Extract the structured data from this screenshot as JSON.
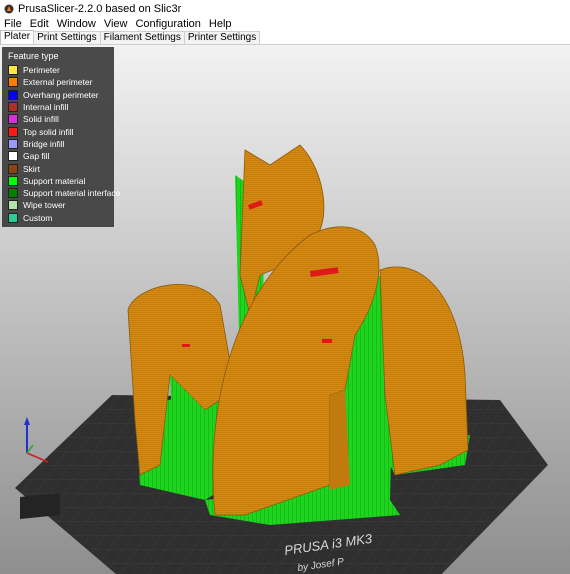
{
  "window": {
    "title": "PrusaSlicer-2.2.0 based on Slic3r",
    "icon": "prusa-slicer-icon"
  },
  "menu": [
    "File",
    "Edit",
    "Window",
    "View",
    "Configuration",
    "Help"
  ],
  "tabs": [
    {
      "label": "Plater",
      "active": true
    },
    {
      "label": "Print Settings",
      "active": false
    },
    {
      "label": "Filament Settings",
      "active": false
    },
    {
      "label": "Printer Settings",
      "active": false
    }
  ],
  "legend": {
    "title": "Feature type",
    "items": [
      {
        "label": "Perimeter",
        "color": "#FFE63A"
      },
      {
        "label": "External perimeter",
        "color": "#FF7D00"
      },
      {
        "label": "Overhang perimeter",
        "color": "#0000FF"
      },
      {
        "label": "Internal infill",
        "color": "#B03029"
      },
      {
        "label": "Solid infill",
        "color": "#D732D7"
      },
      {
        "label": "Top solid infill",
        "color": "#FF1A1A"
      },
      {
        "label": "Bridge infill",
        "color": "#9999FF"
      },
      {
        "label": "Gap fill",
        "color": "#FFFFFF"
      },
      {
        "label": "Skirt",
        "color": "#8B4513"
      },
      {
        "label": "Support material",
        "color": "#00FF00"
      },
      {
        "label": "Support material interface",
        "color": "#008000"
      },
      {
        "label": "Wipe tower",
        "color": "#B3E3AB"
      },
      {
        "label": "Custom",
        "color": "#28CC94"
      }
    ]
  },
  "bed": {
    "label_line1": "PRUSA i3 MK3",
    "label_line2": "by Josef P"
  },
  "colors": {
    "model": "#D58B12",
    "support": "#22DD22",
    "bed": "#3a3a3a",
    "viewport_top": "#f0f0f0",
    "viewport_bottom": "#8a8a8a"
  }
}
